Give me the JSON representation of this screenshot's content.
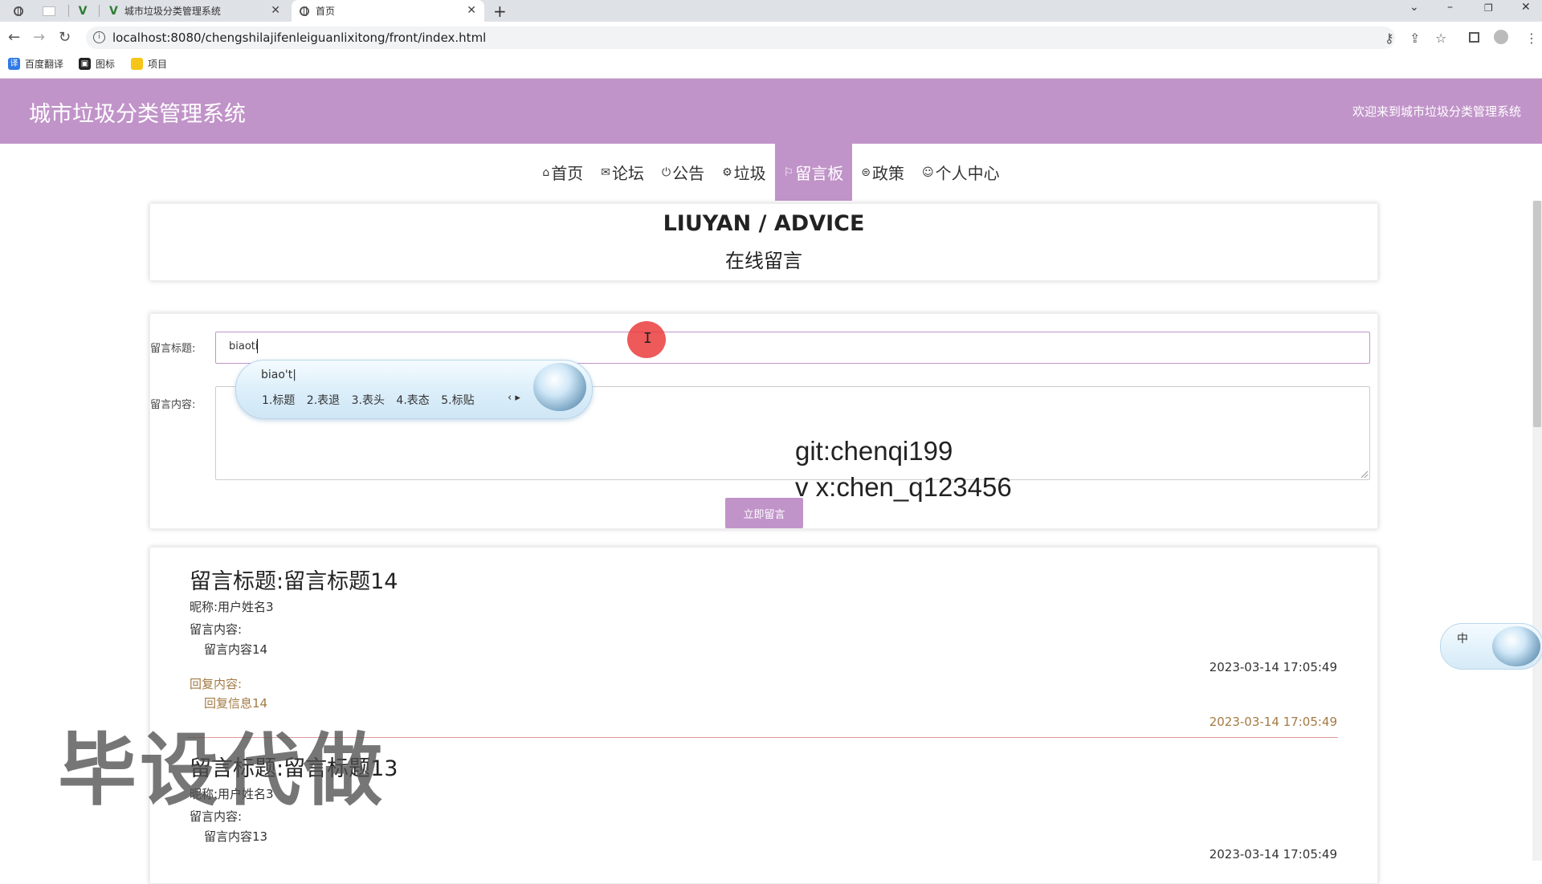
{
  "browser": {
    "tabs": [
      {
        "title": "城市垃圾分类管理系统",
        "active": false
      },
      {
        "title": "首页",
        "active": true
      }
    ],
    "new_tab_symbol": "+",
    "close_symbol": "✕",
    "url": "localhost:8080/chengshilajifenleiguanlixitong/front/index.html",
    "bookmarks": [
      {
        "label": "百度翻译",
        "icon": "translate-icon"
      },
      {
        "label": "图标",
        "icon": "picture-icon"
      },
      {
        "label": "项目",
        "icon": "folder-icon"
      }
    ]
  },
  "header": {
    "title": "城市垃圾分类管理系统",
    "welcome": "欢迎来到城市垃圾分类管理系统"
  },
  "nav": [
    {
      "label": "首页",
      "icon": "home-icon",
      "active": false
    },
    {
      "label": "论坛",
      "icon": "mail-icon",
      "active": false
    },
    {
      "label": "公告",
      "icon": "power-icon",
      "active": false
    },
    {
      "label": "垃圾",
      "icon": "gear-icon",
      "active": false
    },
    {
      "label": "留言板",
      "icon": "flag-icon",
      "active": true
    },
    {
      "label": "政策",
      "icon": "globe-icon",
      "active": false
    },
    {
      "label": "个人中心",
      "icon": "user-icon",
      "active": false
    }
  ],
  "hero": {
    "title_en": "LIUYAN / ADVICE",
    "title_zh": "在线留言"
  },
  "form": {
    "title_label": "留言标题:",
    "title_value": "biaoti",
    "content_label": "留言内容:",
    "submit_label": "立即留言"
  },
  "ime": {
    "pinyin": "biao't|",
    "candidates": "1.标题 2.表退 3.表头 4.表态 5.标贴",
    "mode_label": "中"
  },
  "overlay": {
    "line1": "git:chenqi199",
    "line2": "v x:chen_q123456"
  },
  "messages": [
    {
      "title": "留言标题:留言标题14",
      "nickname": "昵称:用户姓名3",
      "content_label": "留言内容:",
      "content": "留言内容14",
      "date": "2023-03-14 17:05:49",
      "reply_label": "回复内容:",
      "reply": "回复信息14",
      "reply_date": "2023-03-14 17:05:49"
    },
    {
      "title": "留言标题:留言标题13",
      "nickname": "昵称:用户姓名3",
      "content_label": "留言内容:",
      "content": "留言内容13",
      "date": "2023-03-14 17:05:49"
    }
  ],
  "watermark": "毕设代做",
  "colors": {
    "brand": "#c194c9",
    "reply": "#a37a44"
  }
}
